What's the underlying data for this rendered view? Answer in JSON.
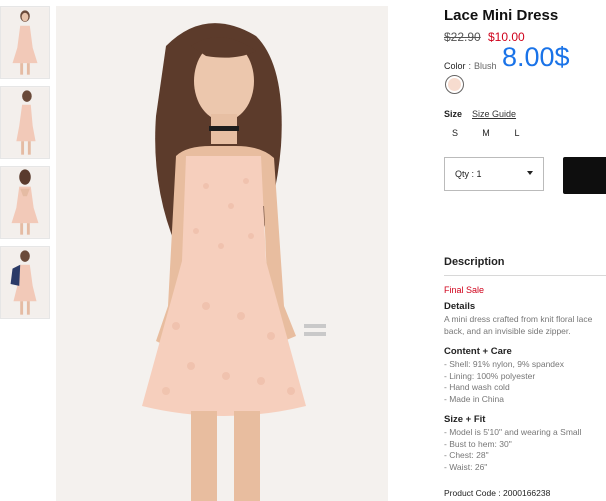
{
  "product": {
    "title": "Lace Mini Dress",
    "original_price": "$22.90",
    "sale_price": "$10.00",
    "promo_price": "8.00$",
    "colors": {
      "accent_red": "#d0021b",
      "promo_blue": "#1a73e8",
      "swatch_blush": "#f7dccf",
      "cart_button": "#0e0e0e"
    }
  },
  "color_option": {
    "label": "Color",
    "separator": ":",
    "value": "Blush"
  },
  "size_option": {
    "label": "Size",
    "guide_link": "Size Guide",
    "sizes": [
      "S",
      "M",
      "L"
    ]
  },
  "quantity": {
    "label": "Qty : 1"
  },
  "description": {
    "heading": "Description",
    "final_sale": "Final Sale",
    "details_heading": "Details",
    "details_lines": [
      "A mini dress crafted from knit floral lace",
      "back, and an invisible side zipper."
    ],
    "content_heading": "Content + Care",
    "content_lines": [
      "- Shell: 91% nylon, 9% spandex",
      "- Lining: 100% polyester",
      "- Hand wash cold",
      "- Made in China"
    ],
    "fit_heading": "Size + Fit",
    "fit_lines": [
      "- Model is 5'10\" and wearing a Small",
      "- Bust to hem: 30\"",
      "- Chest: 28\"",
      "- Waist: 26\""
    ],
    "product_code": "Product Code : 2000166238"
  },
  "gallery": {
    "thumbnail_icons": [
      "dress-front-thumbnail",
      "dress-side-thumbnail",
      "dress-back-thumbnail",
      "dress-jacket-thumbnail"
    ],
    "main_image_icon": "model-wearing-dress-photo"
  }
}
